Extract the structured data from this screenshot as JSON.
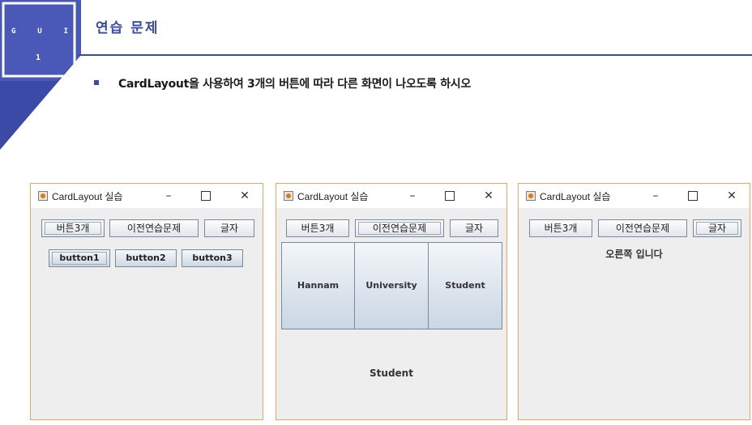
{
  "slide": {
    "logo": {
      "letters": [
        "G",
        "U",
        "I"
      ],
      "number": "1"
    },
    "title": "연습 문제",
    "task": "CardLayout을 사용하여 3개의 버튼에 따라 다른 화면이 나오도록 하시오"
  },
  "windows": [
    {
      "title": "CardLayout 실습",
      "top_buttons": [
        "버튼3개",
        "이전연습문제",
        "글자"
      ],
      "card_buttons": [
        "button1",
        "button2",
        "button3"
      ]
    },
    {
      "title": "CardLayout 실습",
      "top_buttons": [
        "버튼3개",
        "이전연습문제",
        "글자"
      ],
      "card_panels": [
        "Hannam",
        "University",
        "Student"
      ],
      "bottom_label": "Student"
    },
    {
      "title": "CardLayout 실습",
      "top_buttons": [
        "버튼3개",
        "이전연습문제",
        "글자"
      ],
      "message": "오른쪽 입니다"
    }
  ],
  "titlebar_controls": {
    "minimize": "–",
    "close": "✕"
  },
  "colors": {
    "accent": "#3b4aa6",
    "window_border": "#e3a86a",
    "window_bg": "#eeeeee"
  }
}
